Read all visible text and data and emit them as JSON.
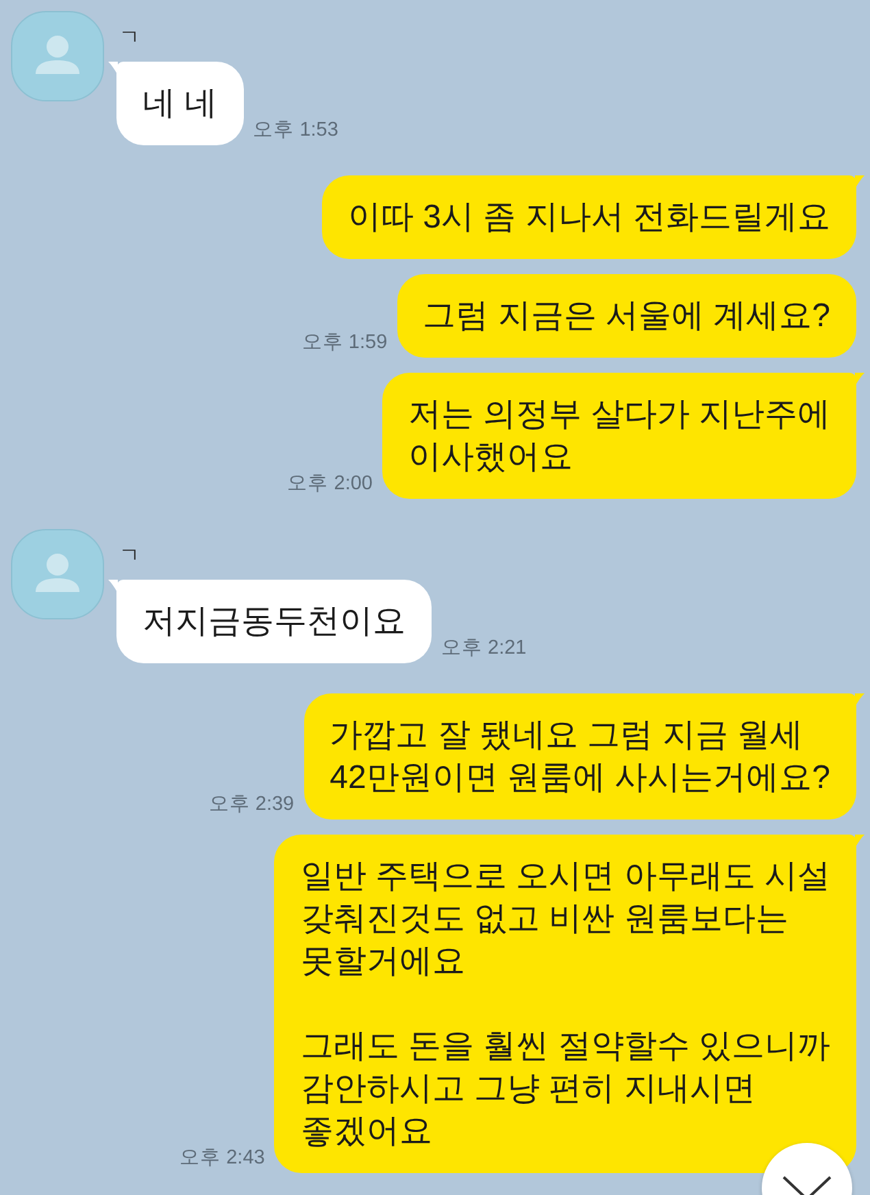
{
  "chat": {
    "messages": [
      {
        "kind": "received",
        "name": "ㄱ",
        "text": "네 네",
        "time": "오후 1:53",
        "tail": true
      },
      {
        "kind": "sent",
        "text": "이따 3시 좀 지나서 전화드릴게요",
        "tail": true
      },
      {
        "kind": "sent",
        "text": "그럼 지금은 서울에 계세요?",
        "time": "오후 1:59",
        "tail": false
      },
      {
        "kind": "sent",
        "text": "저는 의정부 살다가 지난주에\n이사했어요",
        "time": "오후 2:00",
        "tail": true
      },
      {
        "kind": "received",
        "name": "ㄱ",
        "text": "저지금동두천이요",
        "time": "오후 2:21",
        "tail": true
      },
      {
        "kind": "sent",
        "text": "가깝고 잘 됐네요 그럼 지금 월세\n42만원이면 원룸에 사시는거에요?",
        "time": "오후 2:39",
        "tail": true
      },
      {
        "kind": "sent",
        "text": "일반 주택으로 오시면 아무래도 시설\n갖춰진것도 없고 비싼 원룸보다는\n못할거에요\n\n그래도 돈을 훨씬 절약할수 있으니까\n감안하시고 그냥 편히 지내시면\n좋겠어요",
        "time": "오후 2:43",
        "tail": true
      }
    ]
  }
}
